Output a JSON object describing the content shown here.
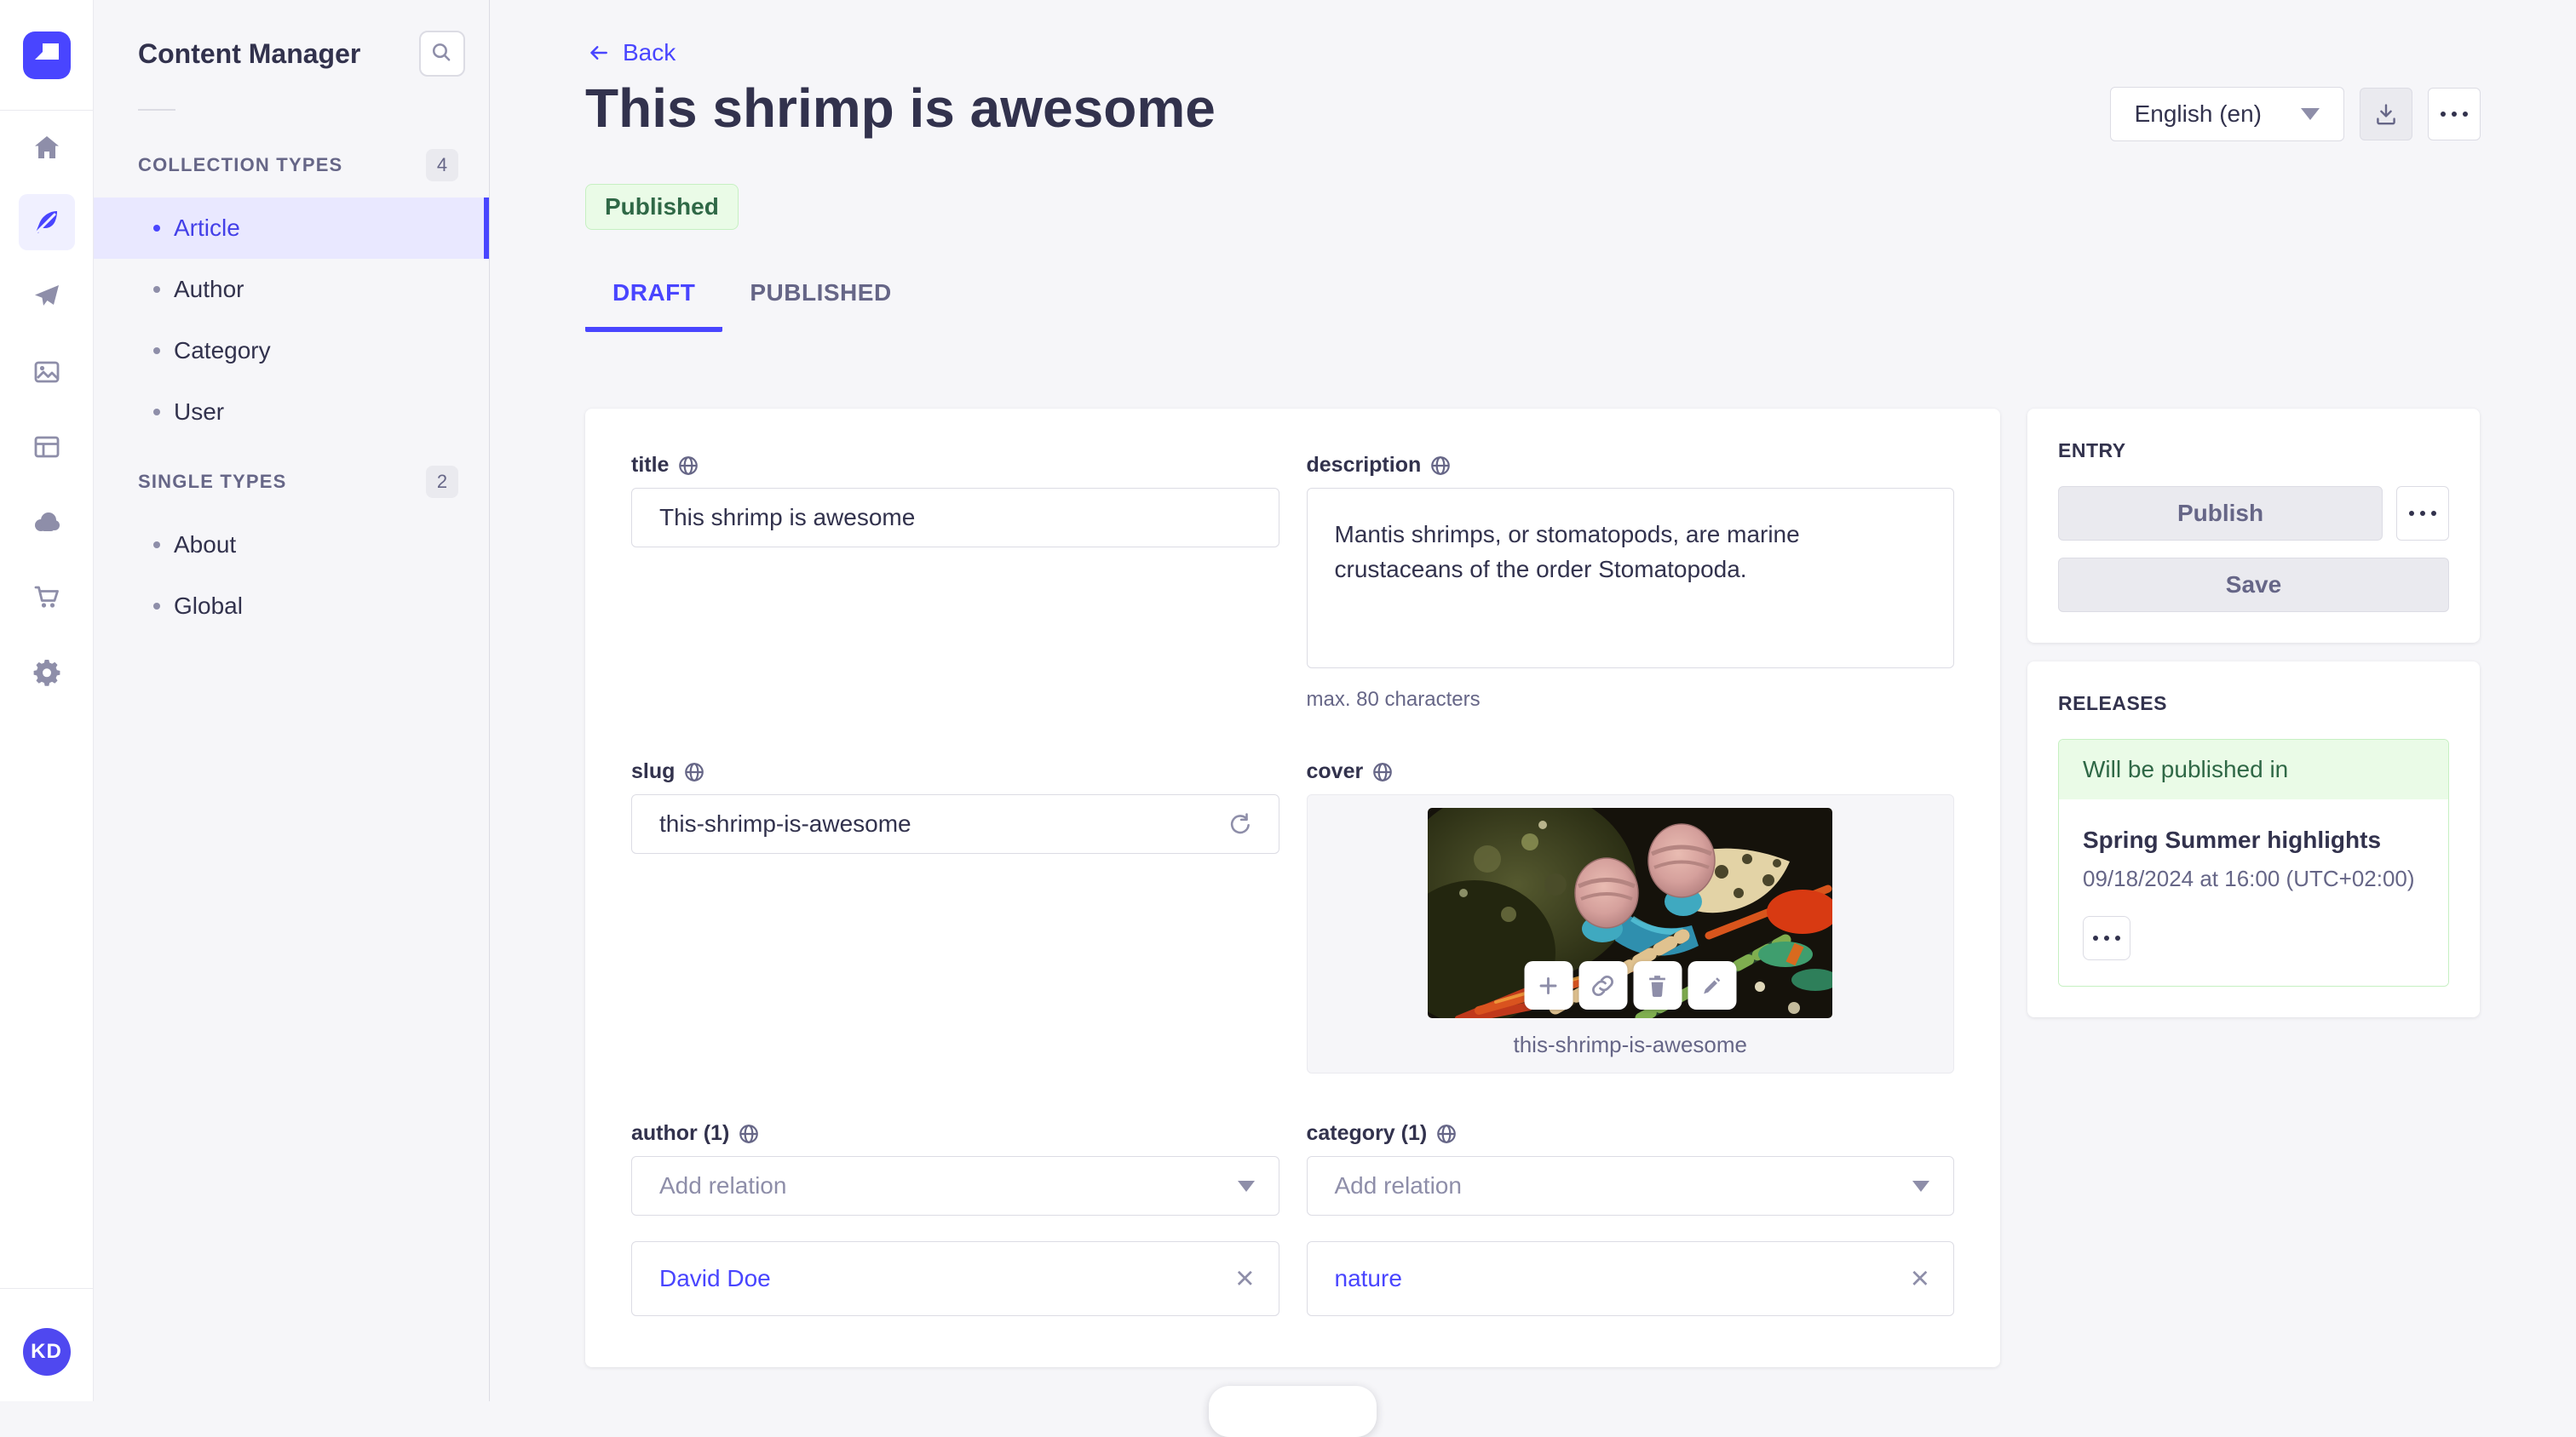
{
  "colors": {
    "primary": "#4945ff",
    "primary_bg": "#f0f0ff",
    "success_text": "#2f6846",
    "success_bg": "#eafbe7",
    "success_border": "#c6f0c2",
    "text": "#32324d",
    "text_subtle": "#666687",
    "placeholder": "#8e8ea9",
    "border": "#dcdce4",
    "page_bg": "#f6f6f9",
    "disabled_bg": "#eaeaef"
  },
  "nav_rail": {
    "logo_icon": "strapi-logo",
    "icons": [
      "home-icon",
      "feather-icon",
      "paper-plane-icon",
      "media-library-icon",
      "layout-icon",
      "cloud-icon",
      "cart-icon",
      "gear-icon"
    ],
    "active_icon": "feather-icon",
    "user_initials": "KD"
  },
  "sidebar": {
    "title": "Content Manager",
    "search_icon": "search-icon",
    "sections": [
      {
        "label": "COLLECTION TYPES",
        "count": "4",
        "active_item": "Article",
        "items": [
          {
            "label": "Article"
          },
          {
            "label": "Author"
          },
          {
            "label": "Category"
          },
          {
            "label": "User"
          }
        ]
      },
      {
        "label": "SINGLE TYPES",
        "count": "2",
        "items": [
          {
            "label": "About"
          },
          {
            "label": "Global"
          }
        ]
      }
    ]
  },
  "header": {
    "back_label": "Back",
    "title": "This shrimp is awesome",
    "status": "Published",
    "locale": {
      "value": "English (en)"
    },
    "download_icon": "download-icon",
    "more_icon": "more-horizontal-icon",
    "active_tab": "DRAFT",
    "tabs": [
      {
        "label": "DRAFT"
      },
      {
        "label": "PUBLISHED"
      }
    ]
  },
  "form": {
    "title": {
      "label": "title",
      "value": "This shrimp is awesome"
    },
    "description": {
      "label": "description",
      "value": "Mantis shrimps, or stomatopods, are marine crustaceans of the order Stomatopoda.",
      "helper": "max. 80 characters"
    },
    "slug": {
      "label": "slug",
      "value": "this-shrimp-is-awesome",
      "action_icon": "regenerate-icon"
    },
    "cover": {
      "label": "cover",
      "caption": "this-shrimp-is-awesome",
      "toolbar_icons": [
        "plus-icon",
        "link-icon",
        "trash-icon",
        "pencil-icon"
      ]
    },
    "author": {
      "label": "author (1)",
      "placeholder": "Add relation",
      "relations": [
        "David Doe"
      ]
    },
    "category": {
      "label": "category (1)",
      "placeholder": "Add relation",
      "relations": [
        "nature"
      ]
    }
  },
  "entry_panel": {
    "title": "ENTRY",
    "publish": "Publish",
    "save": "Save",
    "more_icon": "more-horizontal-icon"
  },
  "releases_panel": {
    "title": "RELEASES",
    "status": "Will be published in",
    "release": {
      "name": "Spring Summer highlights",
      "date": "09/18/2024 at 16:00 (UTC+02:00)"
    },
    "more_icon": "more-horizontal-icon"
  }
}
